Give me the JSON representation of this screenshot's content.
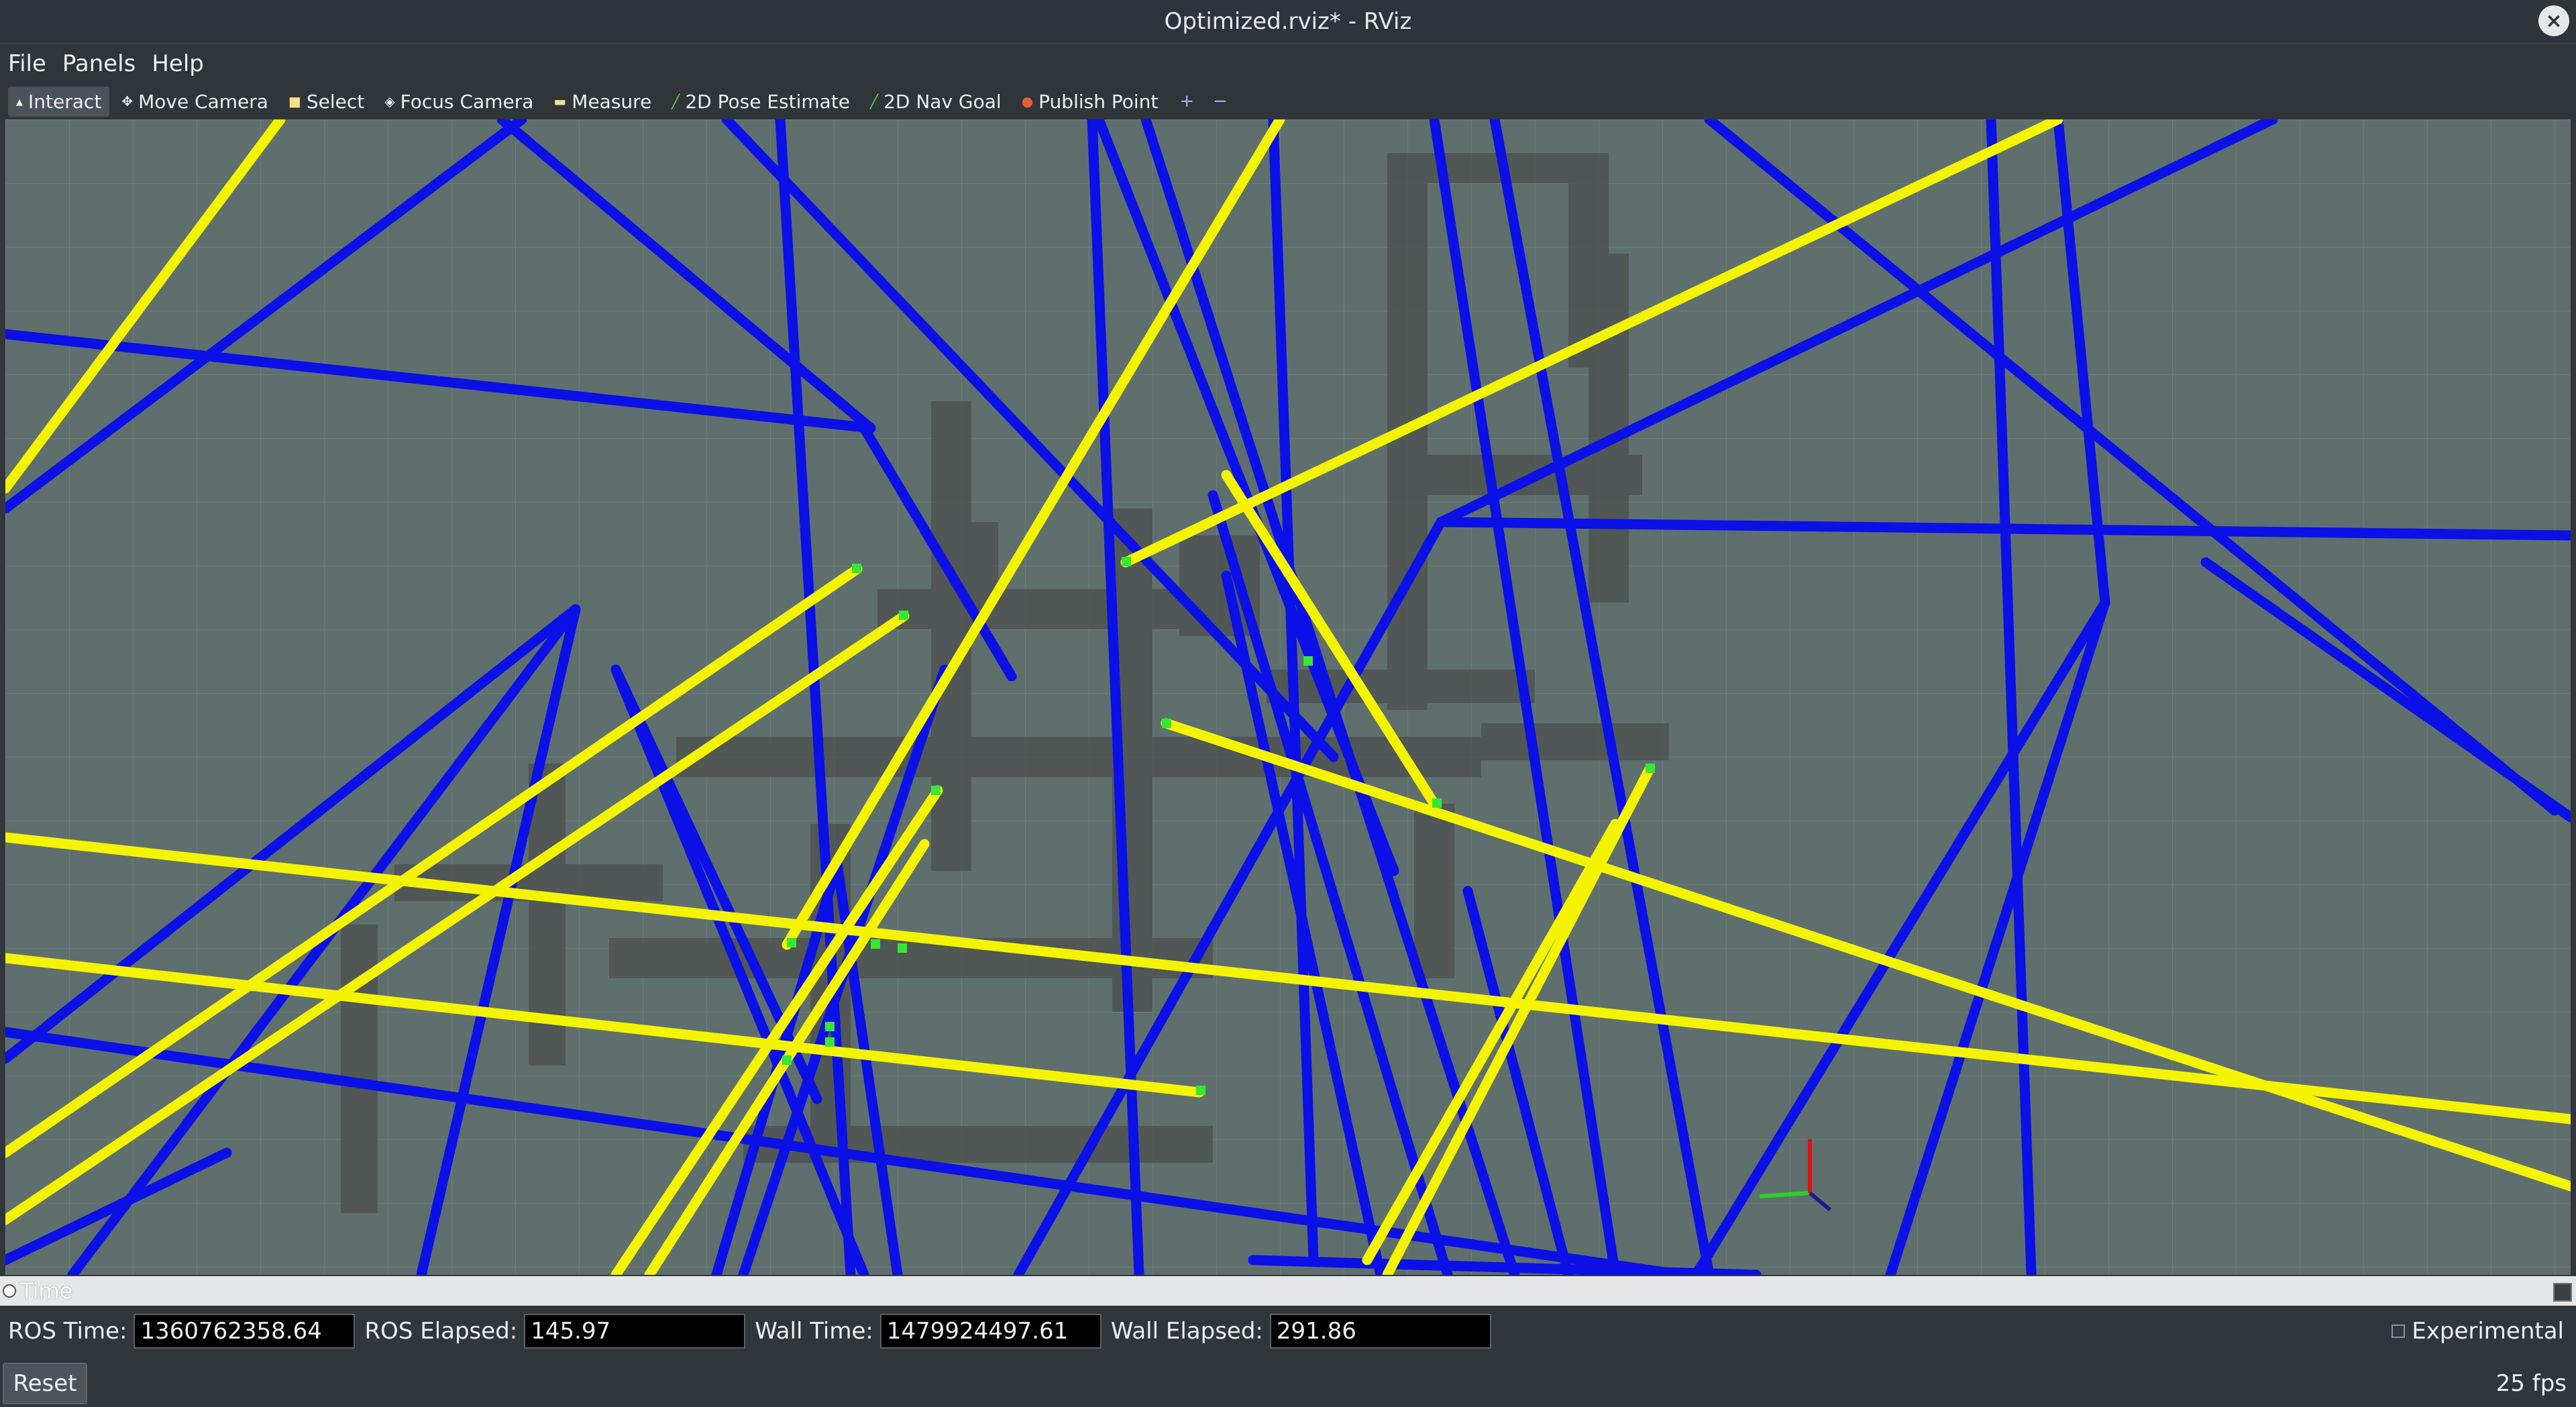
{
  "window": {
    "title": "Optimized.rviz* - RViz"
  },
  "menu": [
    "File",
    "Panels",
    "Help"
  ],
  "toolbar": {
    "tools": [
      {
        "label": "Interact",
        "icon": "pointer-icon",
        "active": true
      },
      {
        "label": "Move Camera",
        "icon": "move-icon",
        "active": false
      },
      {
        "label": "Select",
        "icon": "select-icon",
        "active": false
      },
      {
        "label": "Focus Camera",
        "icon": "focus-icon",
        "active": false
      },
      {
        "label": "Measure",
        "icon": "measure-icon",
        "active": false
      },
      {
        "label": "2D Pose Estimate",
        "icon": "pose-arrow-icon",
        "active": false
      },
      {
        "label": "2D Nav Goal",
        "icon": "nav-goal-icon",
        "active": false
      },
      {
        "label": "Publish Point",
        "icon": "point-icon",
        "active": false
      }
    ],
    "add_symbol": "+",
    "remove_symbol": "−"
  },
  "time_panel": {
    "title": "Time",
    "ros_time_label": "ROS Time:",
    "ros_time": "1360762358.64",
    "ros_elapsed_label": "ROS Elapsed:",
    "ros_elapsed": "145.97",
    "wall_time_label": "Wall Time:",
    "wall_time": "1479924497.61",
    "wall_elapsed_label": "Wall Elapsed:",
    "wall_elapsed": "291.86",
    "experimental_label": "Experimental"
  },
  "status": {
    "reset_label": "Reset",
    "fps": "25 fps"
  },
  "colors": {
    "viewport_bg": "#5f6f6e",
    "blue_lines": "#0a10e6",
    "yellow_lines": "#f4f400",
    "grid": "#6e7d7c",
    "occupancy": "#4a4a4a"
  }
}
